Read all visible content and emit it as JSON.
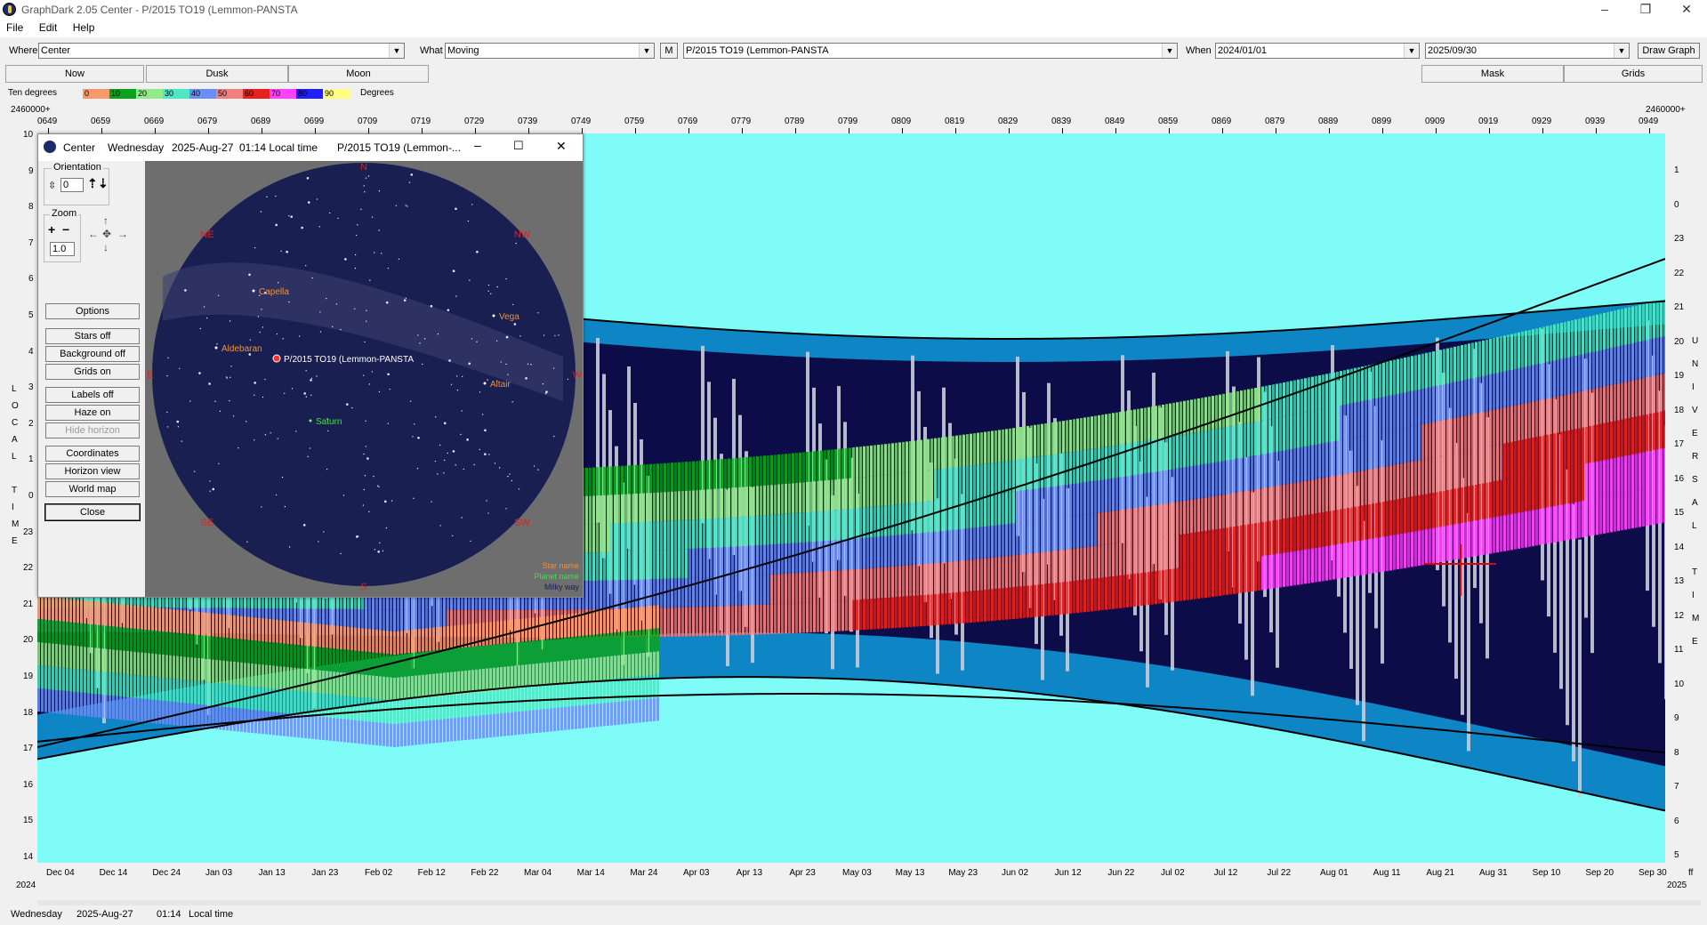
{
  "window": {
    "title": "GraphDark 2.05  Center  -  P/2015 TO19 (Lemmon-PANSTA",
    "min": "–",
    "max": "❐",
    "close": "✕"
  },
  "menu": [
    "File",
    "Edit",
    "Help"
  ],
  "toolbar": {
    "where_label": "Where",
    "where_value": "Center",
    "what_label": "What",
    "what_value": "Moving",
    "m_label": "M",
    "object_value": "P/2015 TO19 (Lemmon-PANSTA",
    "when_label": "When",
    "when_start": "2024/01/01",
    "when_end": "2025/09/30",
    "draw_label": "Draw Graph"
  },
  "tabs": [
    "Now",
    "Dusk",
    "Moon",
    "Mask",
    "Grids"
  ],
  "legend": {
    "label": "Ten degrees",
    "unit": "Degrees",
    "swatches": [
      {
        "text": "0",
        "color": "#f79a6b"
      },
      {
        "text": "10",
        "color": "#0aa21d"
      },
      {
        "text": "20",
        "color": "#91ea8b"
      },
      {
        "text": "30",
        "color": "#4fe6c5"
      },
      {
        "text": "40",
        "color": "#6b8ef2"
      },
      {
        "text": "50",
        "color": "#ef8080"
      },
      {
        "text": "60",
        "color": "#e82020"
      },
      {
        "text": "70",
        "color": "#ff40ff"
      },
      {
        "text": "80",
        "color": "#2020ff"
      },
      {
        "text": "90",
        "color": "#ffff80"
      }
    ]
  },
  "jd": {
    "prefix_left": "2460000+",
    "prefix_right": "2460000+",
    "ticks": [
      "0649",
      "0659",
      "0669",
      "0679",
      "0689",
      "0699",
      "0709",
      "0719",
      "0729",
      "0739",
      "0749",
      "0759",
      "0769",
      "0779",
      "0789",
      "0799",
      "0809",
      "0819",
      "0829",
      "0839",
      "0849",
      "0859",
      "0869",
      "0879",
      "0889",
      "0899",
      "0909",
      "0919",
      "0929",
      "0939",
      "0949"
    ]
  },
  "left_hours": [
    "10",
    "9",
    "8",
    "7",
    "6",
    "5",
    "4",
    "3",
    "2",
    "1",
    "0",
    "23",
    "22",
    "21",
    "20",
    "19",
    "18",
    "17",
    "16",
    "15",
    "14"
  ],
  "right_hours": [
    "1",
    "0",
    "23",
    "22",
    "21",
    "20",
    "19",
    "18",
    "17",
    "16",
    "15",
    "14",
    "13",
    "12",
    "11",
    "10",
    "9",
    "8",
    "7",
    "6",
    "5"
  ],
  "left_axis_title": [
    "L",
    "O",
    "C",
    "A",
    "L",
    "",
    "T",
    "I",
    "M",
    "E"
  ],
  "right_axis_title": [
    "U",
    "N",
    "I",
    "V",
    "E",
    "R",
    "S",
    "A",
    "L",
    "",
    "T",
    "I",
    "M",
    "E"
  ],
  "dates": [
    "Dec 04",
    "Dec 14",
    "Dec 24",
    "Jan 03",
    "Jan 13",
    "Jan 23",
    "Feb 02",
    "Feb 12",
    "Feb 22",
    "Mar 04",
    "Mar 14",
    "Mar 24",
    "Apr 03",
    "Apr 13",
    "Apr 23",
    "May 03",
    "May 13",
    "May 23",
    "Jun 02",
    "Jun 12",
    "Jun 22",
    "Jul 02",
    "Jul 12",
    "Jul 22",
    "Aug 01",
    "Aug 11",
    "Aug 21",
    "Aug 31",
    "Sep 10",
    "Sep 20",
    "Sep 30"
  ],
  "year_left": "2024",
  "year_right": "2025",
  "axis_corner": "ff",
  "status": {
    "day": "Wednesday",
    "date": "2025-Aug-27",
    "time": "01:14",
    "tz": "Local time"
  },
  "popup": {
    "title_app": "Center",
    "title_day": "Wednesday",
    "title_date": "2025-Aug-27",
    "title_time": "01:14 Local time",
    "title_object": "P/2015 TO19 (Lemmon-...",
    "orientation_label": "Orientation",
    "orientation_value": "0",
    "zoom_label": "Zoom",
    "zoom_value": "1.0",
    "buttons": [
      "Options",
      "Stars off",
      "Background off",
      "Grids on",
      "Labels off",
      "Haze on",
      "Hide horizon",
      "Coordinates",
      "Horizon view",
      "World map",
      "Close"
    ],
    "compass": [
      "N",
      "NE",
      "NW",
      "E",
      "W",
      "SE",
      "SW",
      "S"
    ],
    "stars": [
      "Capella",
      "Vega",
      "Aldebaran",
      "Altair"
    ],
    "planets": [
      "Saturn"
    ],
    "target": "P/2015 TO19 (Lemmon-PANSTA",
    "key": [
      "Star name",
      "Planet name",
      "Milky way"
    ]
  },
  "colors": {
    "sky": "#7ffcf8",
    "night": "#0c0c48",
    "twilight": "#0e86c6",
    "moon": "#c8ccd8",
    "black_line": "#000000"
  }
}
